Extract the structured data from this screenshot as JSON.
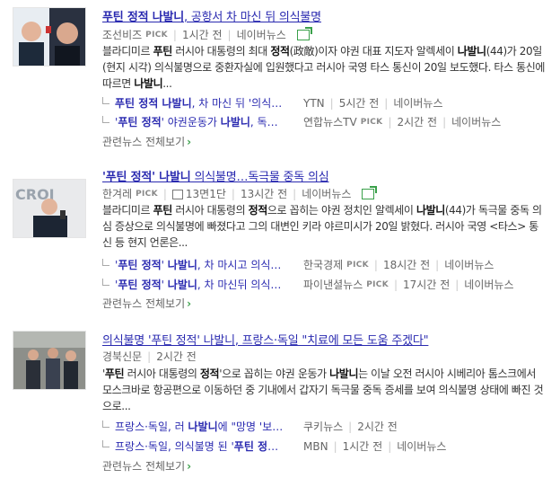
{
  "articles": [
    {
      "title_prefix": "푸틴 정적 나발니",
      "title_rest": ", 공항서 차 마신 뒤 의식불명",
      "source": "조선비즈",
      "pick": "PICK",
      "time": "1시간 전",
      "portal": "네이버뉴스",
      "desc_html": "블라디미르 <b>푸틴</b> 러시아 대통령의 최대 <b>정적</b>(政敵)이자 야권 대표 지도자 알렉세이 <b>나발니</b>(44)가 20일(현지 시각) 의식불명으로 중환자실에 입원했다고 러시아 국영 타스 통신이 20일 보도했다. 타스 통신에 따르면 <b>나발니</b>...",
      "related": [
        {
          "title_html": "<b>푸틴 정적 나발니</b>, 차 마신 뒤 '의식…",
          "source": "YTN",
          "pick": "",
          "time": "5시간 전",
          "portal": "네이버뉴스"
        },
        {
          "title_html": "'<b>푸틴 정적</b>' 야권운동가 <b>나발니</b>, 독…",
          "source": "연합뉴스TV",
          "pick": "PICK",
          "time": "2시간 전",
          "portal": "네이버뉴스"
        }
      ],
      "more": "관련뉴스 전체보기",
      "more_arrow": "›"
    },
    {
      "title_prefix": "'푸틴 정적' 나발니",
      "title_rest": " 의식불명…독극물 중독 의심",
      "source": "한겨레",
      "pick": "PICK",
      "paper": "13면1단",
      "time": "13시간 전",
      "portal": "네이버뉴스",
      "desc_html": "블라디미르 <b>푸틴</b> 러시아 대통령의 <b>정적</b>으로 꼽히는 야권 정치인 알렉세이 <b>나발니</b>(44)가 독극물 중독 의심 증상으로 의식불명에 빠졌다고 그의 대변인 키라 야르미시가 20일 밝혔다. 러시아 국영 &lt;타스&gt; 통신 등 현지 언론은...",
      "related": [
        {
          "title_html": "'<b>푸틴 정적</b>' <b>나발니</b>, 차 마시고 의식…",
          "source": "한국경제",
          "pick": "PICK",
          "time": "18시간 전",
          "portal": "네이버뉴스"
        },
        {
          "title_html": "'<b>푸틴 정적</b>' <b>나발니</b>, 차 마신뒤 의식…",
          "source": "파이낸셜뉴스",
          "pick": "PICK",
          "time": "17시간 전",
          "portal": "네이버뉴스"
        }
      ],
      "more": "관련뉴스 전체보기",
      "more_arrow": "›"
    },
    {
      "title_prefix": "의식불명 '푸틴 정적' 나발니",
      "title_rest": ", 프랑스·독일 \"치료에 모든 도움 주겠다\"",
      "source": "경북신문",
      "pick": "",
      "time": "2시간 전",
      "portal": "",
      "desc_html": "'<b>푸틴</b> 러시아 대통령의 <b>정적</b>'으로 꼽히는 야권 운동가 <b>나발니</b>는 이날 오전 러시아 시베리아 톰스크에서 모스크바로 항공편으로 이동하던 중 기내에서 갑자기 독극물 중독 증세를 보여 의식불명 상태에 빠진 것으로...",
      "related": [
        {
          "title_html": "프랑스·독일, 러 <b>나발니</b>에 \"망명 '보…",
          "source": "쿠키뉴스",
          "pick": "",
          "time": "2시간 전",
          "portal": ""
        },
        {
          "title_html": "프랑스·독일, 의식불명 된 '<b>푸틴 정</b>…",
          "source": "MBN",
          "pick": "",
          "time": "1시간 전",
          "portal": "네이버뉴스"
        }
      ],
      "more": "관련뉴스 전체보기",
      "more_arrow": "›"
    }
  ],
  "colors": {
    "link": "#2a2ab0",
    "accent": "#3aa04a"
  },
  "icons": {
    "share": "share-icon",
    "paper": "newspaper-icon"
  }
}
